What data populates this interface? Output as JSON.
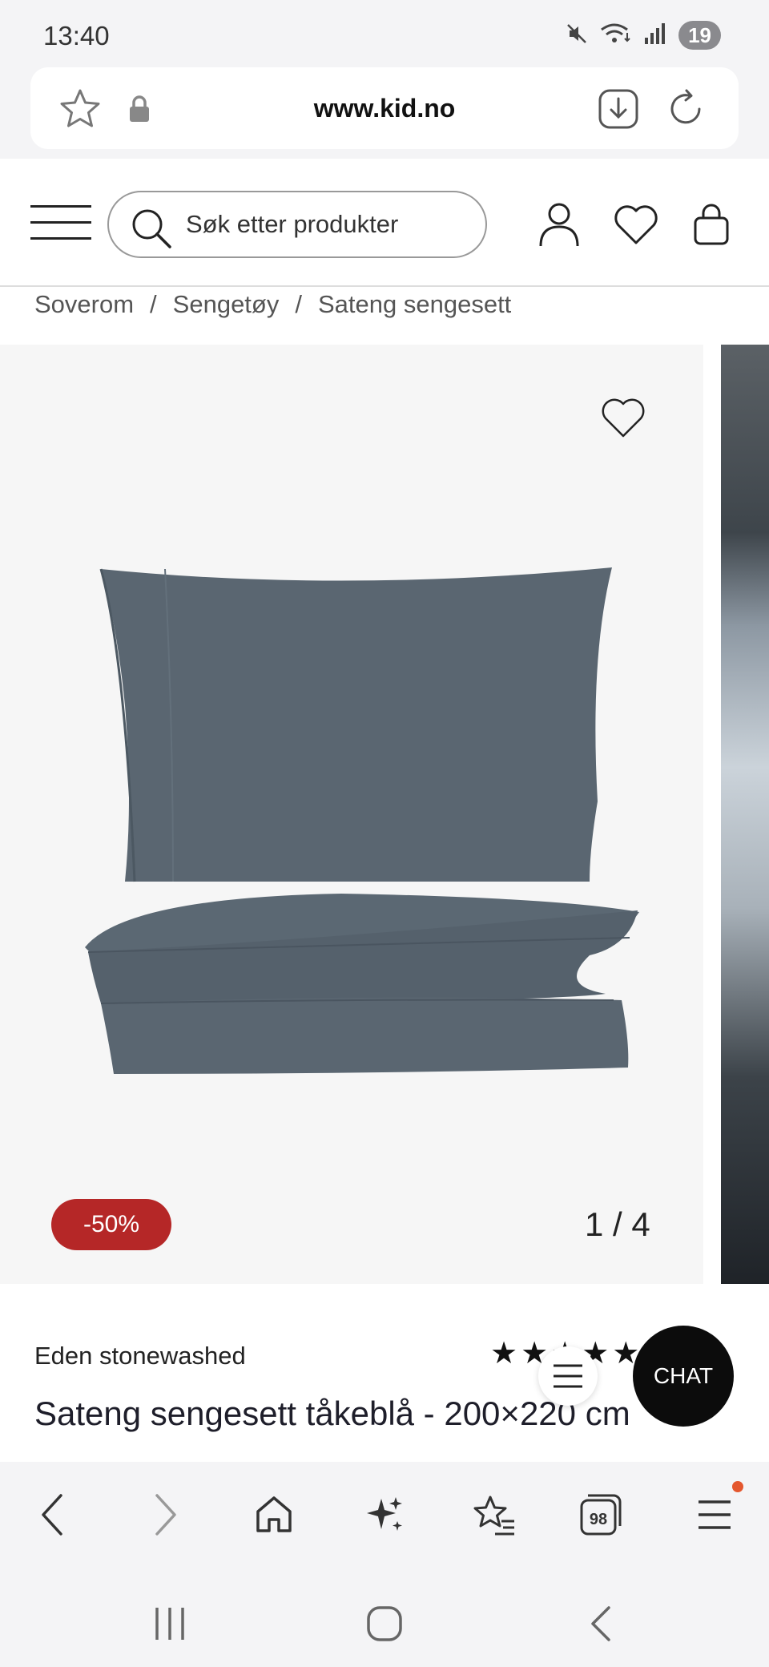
{
  "status_bar": {
    "time": "13:40",
    "battery": "19",
    "icons": [
      "mute-icon",
      "wifi-icon",
      "signal-icon"
    ]
  },
  "address_bar": {
    "url": "www.kid.no",
    "icons": [
      "star-icon",
      "lock-icon",
      "download-icon",
      "reload-icon"
    ]
  },
  "header": {
    "search_placeholder": "Søk etter produkter",
    "icons": [
      "menu-icon",
      "account-icon",
      "wishlist-icon",
      "cart-icon"
    ]
  },
  "breadcrumb": {
    "items": [
      "Soverom",
      "Sengetøy",
      "Sateng sengesett"
    ],
    "separator": "/"
  },
  "gallery": {
    "discount": "-50%",
    "counter": "1 / 4",
    "current_index": 1,
    "total": 4,
    "discount_color": "#b52727"
  },
  "product": {
    "brand": "Eden stonewashed",
    "rating_stars": "★★★★★",
    "title": "Sateng sengesett tåkeblå - 200×220 cm"
  },
  "chat": {
    "label": "CHAT"
  },
  "browser_nav": {
    "tabs_count": "98",
    "icons": [
      "back-icon",
      "forward-icon",
      "home-icon",
      "ai-sparkle-icon",
      "bookmarks-icon",
      "tabs-icon",
      "menu-icon"
    ]
  },
  "system_nav": {
    "icons": [
      "recents-icon",
      "home-icon",
      "back-icon"
    ]
  }
}
